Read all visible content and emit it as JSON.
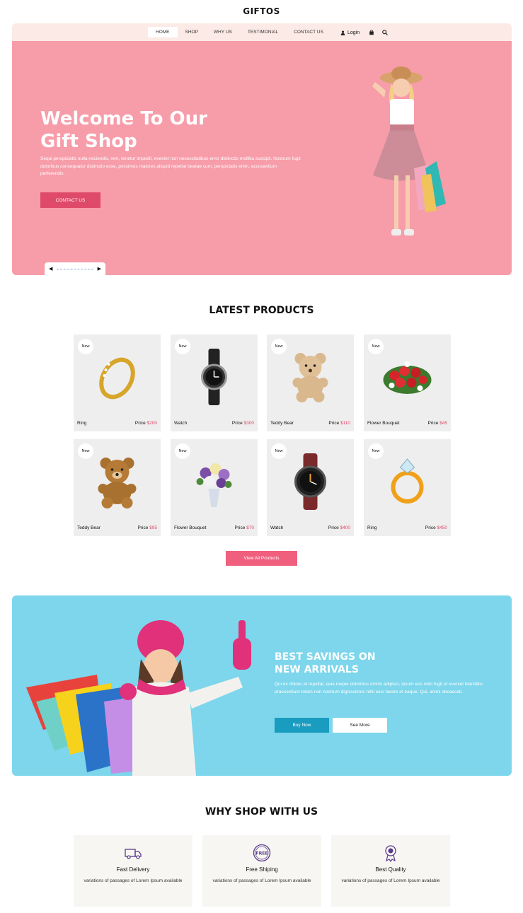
{
  "brand": "GIFTOS",
  "nav": {
    "items": [
      {
        "label": "HOME",
        "active": true
      },
      {
        "label": "SHOP",
        "active": false
      },
      {
        "label": "WHY US",
        "active": false
      },
      {
        "label": "TESTIMONIAL",
        "active": false
      },
      {
        "label": "CONTACT US",
        "active": false
      }
    ],
    "login_label": "Login",
    "icons": [
      "user-icon",
      "cart-icon",
      "search-icon"
    ]
  },
  "hero": {
    "title_line1": "Welcome To Our",
    "title_line2": "Gift Shop",
    "text": "Sequi perspiciatis nulla reiciendis, rem, tenetur impedit, eveniet non necessitatibus error distinctio mollitia suscipit. Nostrum fugit doloribus consequatur distinctio esse, possimus maiores aliquid repellat beatae cum, perspiciatis enim, accusantium perferendis.",
    "cta_label": "CONTACT US",
    "bg_color": "#f79ca9",
    "cta_color": "#df4a6a"
  },
  "latest": {
    "title": "LATEST PRODUCTS",
    "products": [
      {
        "badge": "New",
        "name": "Ring",
        "price_label": "Price",
        "price": "$200",
        "icon": "ring-icon"
      },
      {
        "badge": "New",
        "name": "Watch",
        "price_label": "Price",
        "price": "$300",
        "icon": "watch-icon"
      },
      {
        "badge": "New",
        "name": "Teddy Bear",
        "price_label": "Price",
        "price": "$110",
        "icon": "teddy-bear-icon"
      },
      {
        "badge": "New",
        "name": "Flower Bouquet",
        "price_label": "Price",
        "price": "$45",
        "icon": "bouquet-icon"
      },
      {
        "badge": "New",
        "name": "Teddy Bear",
        "price_label": "Price",
        "price": "$95",
        "icon": "teddy-bear-icon"
      },
      {
        "badge": "New",
        "name": "Flower Bouquet",
        "price_label": "Price",
        "price": "$70",
        "icon": "bouquet-icon"
      },
      {
        "badge": "New",
        "name": "Watch",
        "price_label": "Price",
        "price": "$400",
        "icon": "watch-icon"
      },
      {
        "badge": "New",
        "name": "Ring",
        "price_label": "Price",
        "price": "$450",
        "icon": "ring-icon"
      }
    ],
    "view_all_label": "View All Products"
  },
  "promo": {
    "title_line1": "BEST SAVINGS ON",
    "title_line2": "NEW ARRIVALS",
    "text": "Qui ex dolore at repellat, quia neque doloribus omnis adipisci, ipsum eos odio fugit ut eveniet blanditiis praesentium totam non nostrum dignissimos nihil eius facere et eaque. Qui, animi obcaecati.",
    "buy_label": "Buy Now",
    "see_label": "See More",
    "bg_color": "#7dd6eb"
  },
  "why": {
    "title": "WHY SHOP WITH US",
    "features": [
      {
        "title": "Fast Delivery",
        "text": "variations of passages of Lorem Ipsum available",
        "icon": "delivery-truck-icon"
      },
      {
        "title": "Free Shiping",
        "text": "variations of passages of Lorem Ipsum available",
        "icon": "free-badge-icon",
        "icon_text": "FREE"
      },
      {
        "title": "Best Quality",
        "text": "variations of passages of Lorem Ipsum available",
        "icon": "quality-medal-icon"
      }
    ]
  }
}
